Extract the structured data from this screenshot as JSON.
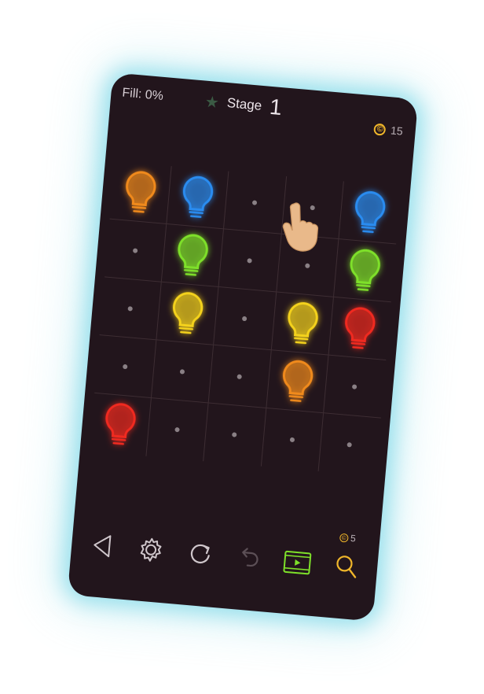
{
  "hud": {
    "fill_text": "Fill: 0%",
    "stage_label": "Stage",
    "stage_number": "1",
    "star_icon": "star-icon",
    "coins": "15",
    "coin_symbol": "©"
  },
  "board": {
    "rows": 5,
    "cols": 5,
    "cells": [
      [
        "orange",
        "blue",
        "dot",
        "dot",
        "blue"
      ],
      [
        "dot",
        "green",
        "dot",
        "dot",
        "green"
      ],
      [
        "dot",
        "yellow",
        "dot",
        "yellow",
        "red"
      ],
      [
        "dot",
        "dot",
        "dot",
        "orange",
        "dot"
      ],
      [
        "red",
        "dot",
        "dot",
        "dot",
        "dot"
      ]
    ],
    "colors": {
      "orange": "#f08a1c",
      "blue": "#2a8cf0",
      "green": "#7ee02a",
      "yellow": "#f4d21c",
      "red": "#f02a20"
    }
  },
  "tutorial": {
    "hand_icon": "pointing-hand-icon"
  },
  "toolbar": {
    "back_icon": "back-triangle-icon",
    "settings_icon": "gear-icon",
    "restart_icon": "restart-icon",
    "undo_icon": "undo-icon",
    "video_icon": "video-reward-icon",
    "hint_icon": "magnifier-icon",
    "hint_cost": "5",
    "hint_coin_symbol": "©",
    "accent_video": "#7ee02a",
    "accent_hint": "#f0b62a"
  }
}
